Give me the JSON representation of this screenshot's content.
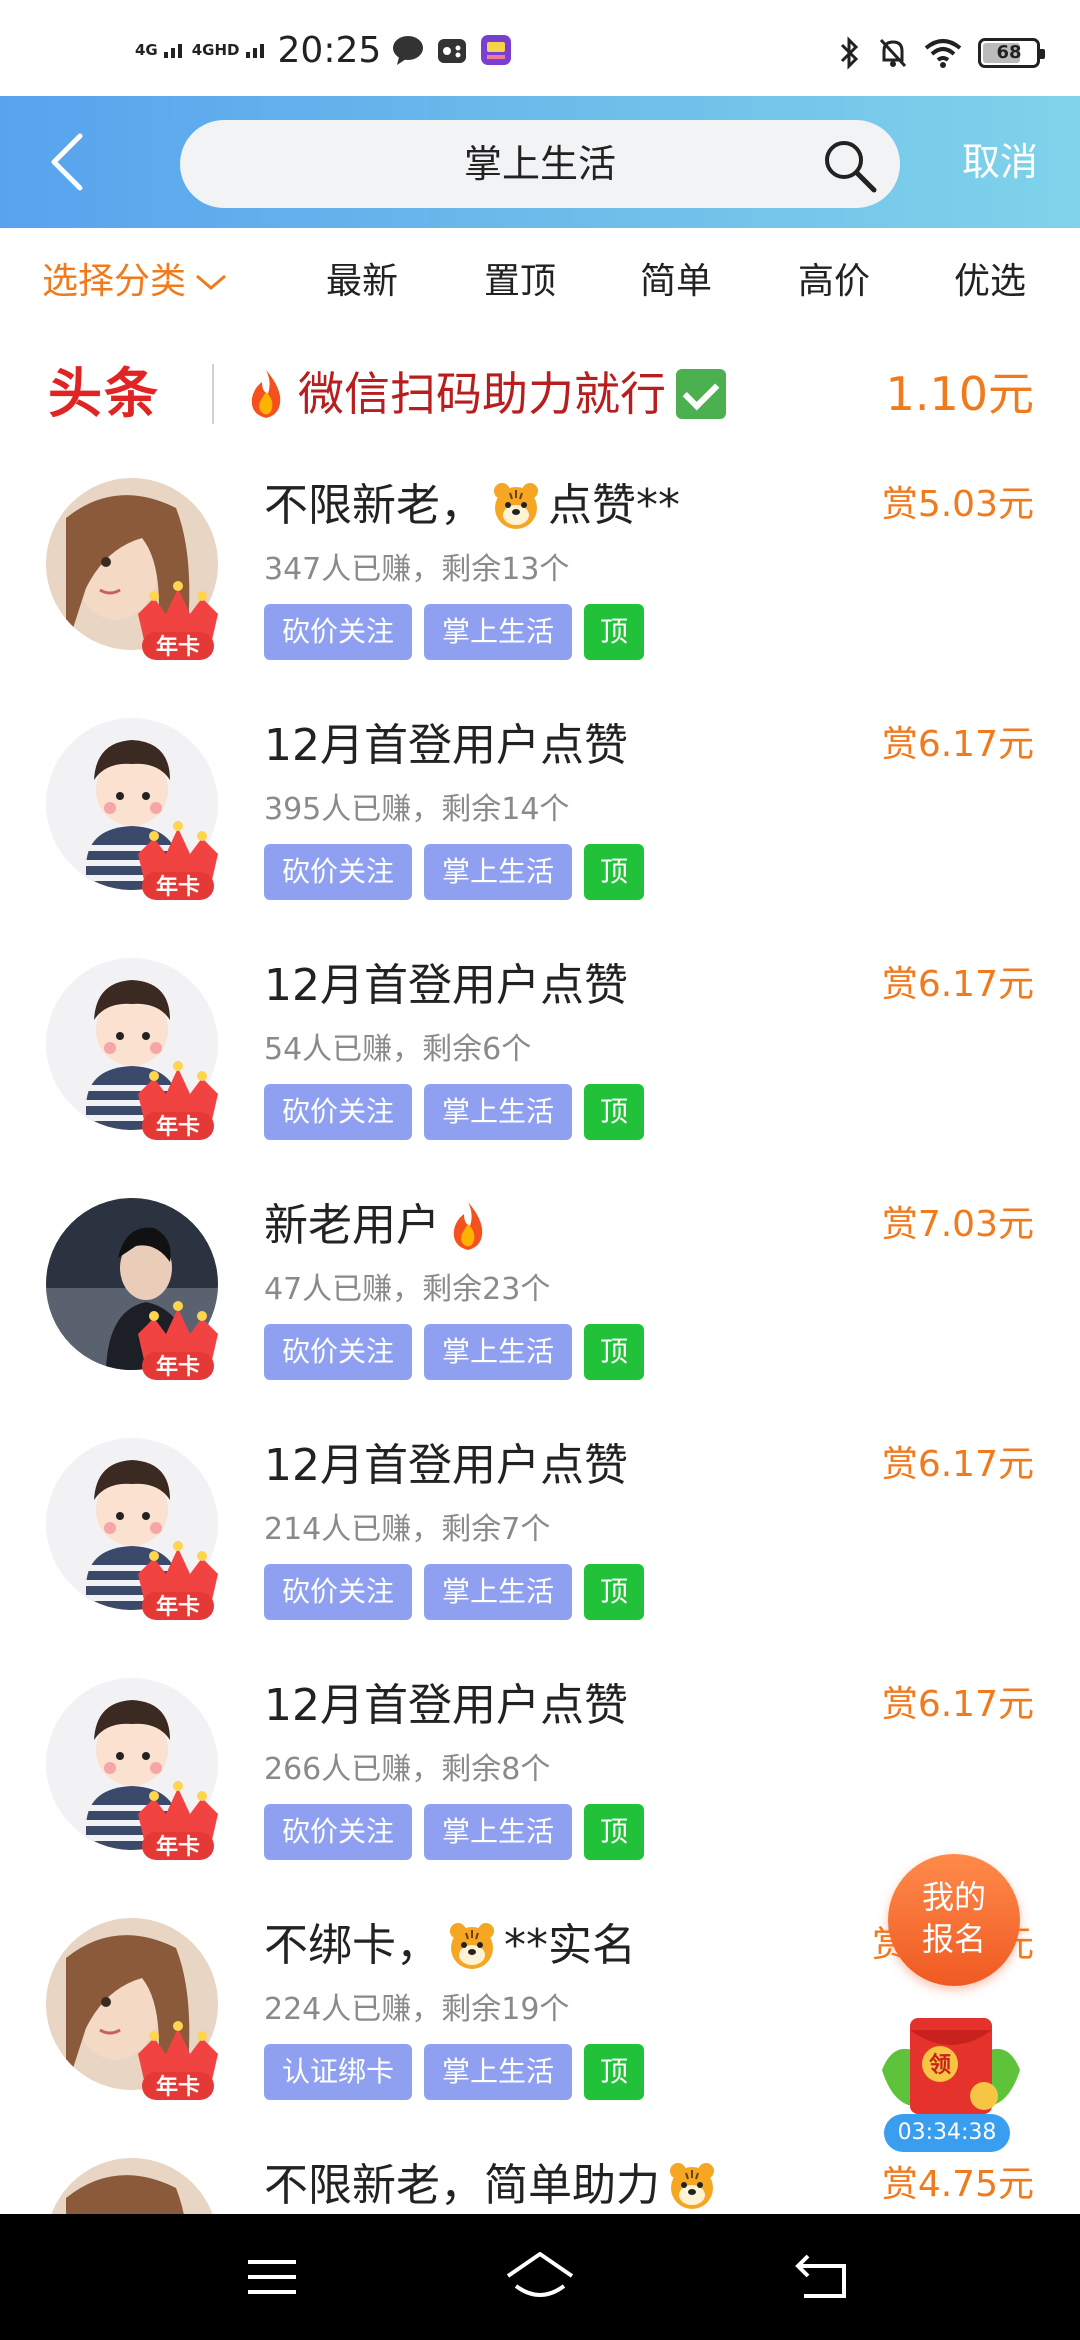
{
  "status_bar": {
    "signal1": "4G",
    "signal2": "4GHD",
    "time": "20:25",
    "battery": "68"
  },
  "header": {
    "search_value": "掌上生活",
    "cancel_label": "取消"
  },
  "filters": {
    "category_label": "选择分类",
    "tabs": [
      "最新",
      "置顶",
      "简单",
      "高价",
      "优选"
    ]
  },
  "headline": {
    "logo": "头条",
    "text": "微信扫码助力就行",
    "price": "1.10元"
  },
  "tasks": [
    {
      "title": "不限新老，",
      "title_suffix": "点赞**",
      "reward": "赏5.03元",
      "stats": "347人已赚，剩余13个",
      "tags": [
        "砍价关注",
        "掌上生活",
        "顶"
      ]
    },
    {
      "title": "12月首登用户点赞",
      "reward": "赏6.17元",
      "stats": "395人已赚，剩余14个",
      "tags": [
        "砍价关注",
        "掌上生活",
        "顶"
      ]
    },
    {
      "title": "12月首登用户点赞",
      "reward": "赏6.17元",
      "stats": "54人已赚，剩余6个",
      "tags": [
        "砍价关注",
        "掌上生活",
        "顶"
      ]
    },
    {
      "title": "新老用户",
      "reward": "赏7.03元",
      "stats": "47人已赚，剩余23个",
      "tags": [
        "砍价关注",
        "掌上生活",
        "顶"
      ]
    },
    {
      "title": "12月首登用户点赞",
      "reward": "赏6.17元",
      "stats": "214人已赚，剩余7个",
      "tags": [
        "砍价关注",
        "掌上生活",
        "顶"
      ]
    },
    {
      "title": "12月首登用户点赞",
      "reward": "赏6.17元",
      "stats": "266人已赚，剩余8个",
      "tags": [
        "砍价关注",
        "掌上生活",
        "顶"
      ]
    },
    {
      "title": "不绑卡，",
      "title_suffix": "**实名",
      "reward": "赏",
      "reward_tail": "元",
      "stats": "224人已赚，剩余19个",
      "tags": [
        "认证绑卡",
        "掌上生活",
        "顶"
      ]
    },
    {
      "title": "不限新老，简单助力",
      "reward": "赏4.75元"
    }
  ],
  "badge_label": "年卡",
  "floating": {
    "signup_line1": "我的",
    "signup_line2": "报名",
    "redpacket_label": "领",
    "countdown": "03:34:38"
  },
  "colors": {
    "accent_orange": "#f07b1d",
    "header_blue": "#57a3ee",
    "tag_blue": "#8fa0f0",
    "tag_green": "#22c13a",
    "headline_red": "#e02323"
  }
}
